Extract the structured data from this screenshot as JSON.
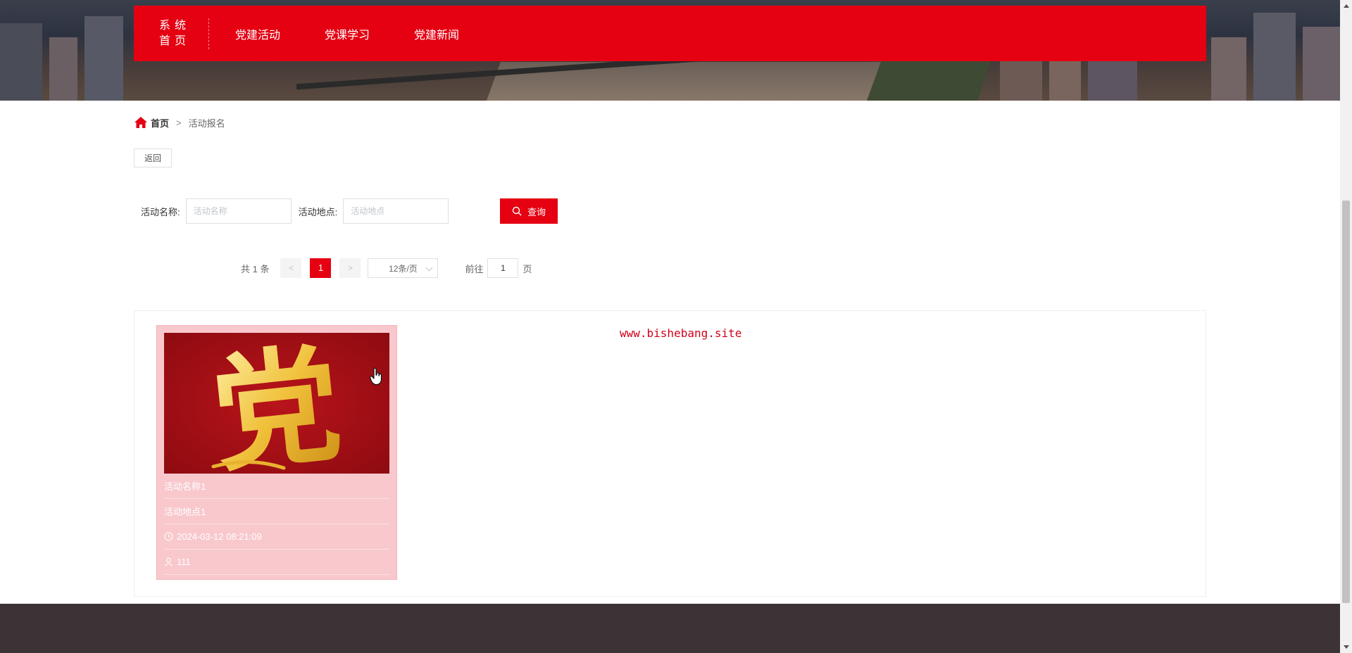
{
  "nav": {
    "home_line1": "系统",
    "home_line2": "首页",
    "items": [
      {
        "label": "党建活动"
      },
      {
        "label": "党课学习"
      },
      {
        "label": "党建新闻"
      }
    ]
  },
  "breadcrumb": {
    "home_icon": "home-icon",
    "home": "首页",
    "separator": ">",
    "current": "活动报名"
  },
  "back_label": "返回",
  "search": {
    "name_label": "活动名称:",
    "name_placeholder": "活动名称",
    "location_label": "活动地点:",
    "location_placeholder": "活动地点",
    "button_label": "查询",
    "button_icon": "search-icon"
  },
  "pagination": {
    "total_text": "共 1 条",
    "prev": "<",
    "current_page": "1",
    "next": ">",
    "page_size": "12条/页",
    "goto_prefix": "前往",
    "goto_value": "1",
    "goto_suffix": "页"
  },
  "watermark": "www.bishebang.site",
  "cards": [
    {
      "image_glyph": "党",
      "name": "活动名称1",
      "location": "活动地点1",
      "time": "2024-03-12 08:21:09",
      "count": "111"
    }
  ],
  "colors": {
    "brand_red": "#e50012",
    "card_bg": "#f8c8cd",
    "footer_bg": "#3d3336"
  }
}
